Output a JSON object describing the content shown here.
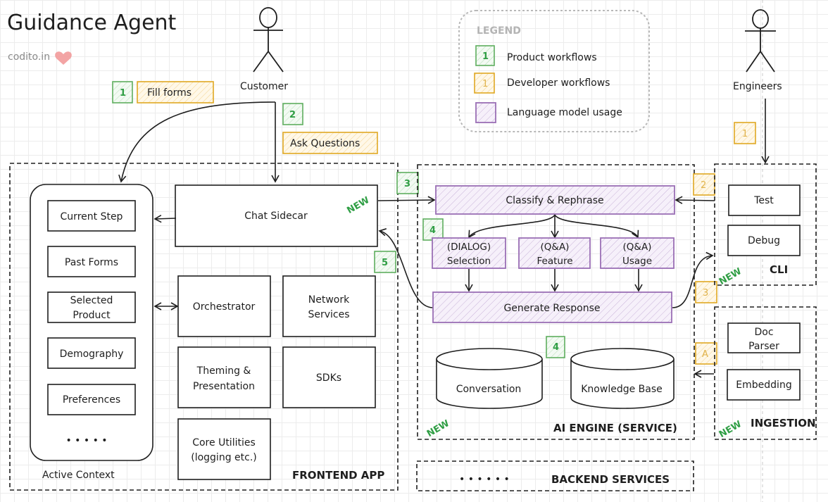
{
  "header": {
    "title": "Guidance Agent",
    "credit": "codito.in",
    "credit_icon": "heart-icon"
  },
  "colors": {
    "product": "#2f9e44",
    "developer": "#e0a823",
    "language_model": "#9a6fb5",
    "heart": "#f08c8c"
  },
  "legend": {
    "title": "LEGEND",
    "items": [
      {
        "badge": "1",
        "label": "Product workflows",
        "kind": "green"
      },
      {
        "badge": "1",
        "label": "Developer workflows",
        "kind": "yellow"
      },
      {
        "badge": "",
        "label": "Language model usage",
        "kind": "purple"
      }
    ]
  },
  "actors": {
    "customer": "Customer",
    "engineers": "Engineers"
  },
  "steps": {
    "fill_forms_badge": "1",
    "fill_forms": "Fill forms",
    "ask_questions_badge": "2",
    "ask_questions": "Ask Questions",
    "to_ai_badge": "3",
    "classify_badge": "4",
    "response_badge": "5",
    "store_badge": "4",
    "eng_badge_1": "1",
    "eng_badge_2": "2",
    "eng_badge_3": "3",
    "eng_badge_a": "A"
  },
  "frontend": {
    "label": "FRONTEND APP",
    "active_context": {
      "label": "Active Context",
      "items": [
        "Current Step",
        "Past Forms",
        "Selected Product",
        "Demography",
        "Preferences"
      ],
      "more": "• • • • •"
    },
    "chat_sidecar": "Chat Sidecar",
    "new_tag": "NEW",
    "modules": {
      "orchestrator": "Orchestrator",
      "network": [
        "Network",
        "Services"
      ],
      "theming": [
        "Theming &",
        "Presentation"
      ],
      "sdks": "SDKs",
      "core": [
        "Core Utilities",
        "(logging etc.)"
      ]
    }
  },
  "ai_engine": {
    "label": "AI ENGINE (SERVICE)",
    "new_tag": "NEW",
    "classify": "Classify & Rephrase",
    "branches": [
      {
        "line1": "(DIALOG)",
        "line2": "Selection"
      },
      {
        "line1": "(Q&A)",
        "line2": "Feature"
      },
      {
        "line1": "(Q&A)",
        "line2": "Usage"
      }
    ],
    "generate": "Generate Response",
    "stores": [
      "Conversation",
      "Knowledge Base"
    ]
  },
  "cli": {
    "label": "CLI",
    "new_tag": "NEW",
    "items": [
      "Test",
      "Debug"
    ]
  },
  "ingestion": {
    "label": "INGESTION",
    "new_tag": "NEW",
    "items": [
      [
        "Doc",
        "Parser"
      ],
      "Embedding"
    ]
  },
  "backend": {
    "label": "BACKEND SERVICES",
    "more": "• • • • • •"
  }
}
